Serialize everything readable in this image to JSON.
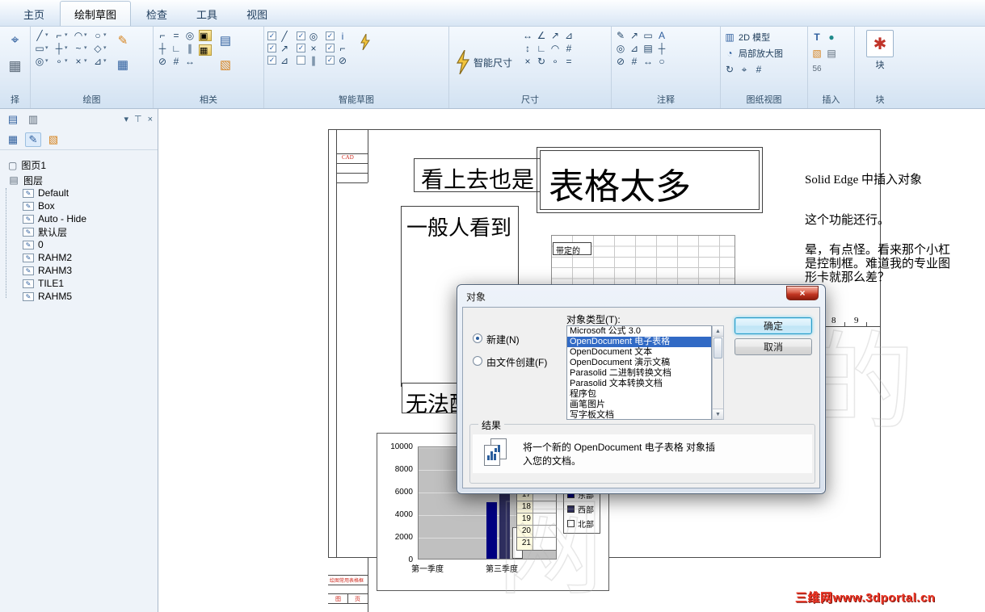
{
  "tabs": {
    "items": [
      "主页",
      "绘制草图",
      "检查",
      "工具",
      "视图"
    ],
    "active_index": 1
  },
  "ribbon": {
    "groups": {
      "select": "择",
      "draw": "绘图",
      "relate": "相关",
      "intellisketch": "智能草图",
      "dimension": "尺寸",
      "annotation": "注释",
      "drawing_views": "图纸视图",
      "insert": "插入",
      "block": "块"
    },
    "buttons": {
      "smart_dimension": "智能尺寸",
      "model_2d": "2D 模型",
      "detail_view": "局部放大图",
      "block": "块"
    }
  },
  "icons": {
    "caret": "▾",
    "cursor": "⌖",
    "fence": "▦",
    "line": "╱",
    "corner": "⌐",
    "circle": "○",
    "ellipse": "◯",
    "rect": "▭",
    "diamond": "◇",
    "arc": "◠",
    "curve": "~",
    "plus": "┼",
    "equal": "=",
    "perp": "∟",
    "parallel": "∥",
    "target": "◎",
    "dot": "∘",
    "angle": "∠",
    "tri": "⊿",
    "cross": "×",
    "tangent": "⊘",
    "info": "i",
    "check": "✓",
    "pencil": "✎",
    "dim_h": "↔",
    "dim_v": "↕",
    "leader": "↗",
    "text": "A",
    "table": "▤",
    "view2d": "▥",
    "detail": "◔",
    "refresh": "↻",
    "hash": "#",
    "letterT": "T",
    "sphere": "●",
    "image": "▧",
    "star": "✱",
    "pin": "⊤",
    "close": "×",
    "chevron_down": "▾",
    "lock": "▣",
    "num56": "56",
    "page": "▢",
    "layers": "▤"
  },
  "panel": {
    "sheet": "图页1",
    "root": "图层",
    "layers": [
      "Default",
      "Box",
      "Auto - Hide",
      "默认层",
      "0",
      "RAHM2",
      "RAHM3",
      "TILE1",
      "RAHM5"
    ]
  },
  "canvas": {
    "textbox_1": "看上去也是",
    "textbox_2": "表格太多",
    "textbox_3": "一般人看到",
    "textbox_4": "无法配",
    "grid_label": "带定的",
    "cad_stamp": "CAD",
    "title_block_row": "绘图常用表格框",
    "title_block_c1": "图",
    "title_block_c2": "页",
    "ruler_8": "8",
    "ruler_9": "9",
    "note_1": "Solid Edge 中插入对象",
    "note_2": "这个功能还行。",
    "note_3": "晕，有点怪。看来那个小杠",
    "note_4": "是控制框。难道我的专业图",
    "note_5": "形卡就那么差？",
    "watermark_url": "三维网www.3dportal.cn",
    "watermark_glyph_1": "的",
    "watermark_glyph_2": "网"
  },
  "chart_data": {
    "type": "bar",
    "title": "",
    "categories": [
      "第一季度",
      "第三季度"
    ],
    "y_ticks": [
      "10000",
      "8000",
      "6000",
      "4000",
      "2000",
      "0"
    ],
    "ylim": [
      0,
      10000
    ],
    "legend": [
      "东部",
      "西部",
      "北部"
    ],
    "legend_position": "right",
    "plot_background": "#c0c0c0",
    "grid": true,
    "data_table_values": [
      "17",
      "18",
      "19",
      "20",
      "21"
    ],
    "series": [
      {
        "name": "东部",
        "color": "#000080",
        "visible_values": [
          null,
          5000
        ]
      },
      {
        "name": "西部",
        "color": "#2e2e5e",
        "visible_values": [
          null,
          6000
        ]
      },
      {
        "name": "北部",
        "color": "#ffffff",
        "visible_values": [
          null,
          2800
        ]
      }
    ]
  },
  "dialog": {
    "title": "对象",
    "type_label": "对象类型(T):",
    "radio_new": "新建(N)",
    "radio_file": "由文件创建(F)",
    "list_items": [
      "Microsoft 公式 3.0",
      "OpenDocument 电子表格",
      "OpenDocument 文本",
      "OpenDocument 演示文稿",
      "Parasolid 二进制转换文档",
      "Parasolid 文本转换文档",
      "程序包",
      "画笔图片",
      "写字板文档"
    ],
    "selected_index": 1,
    "ok": "确定",
    "cancel": "取消",
    "result_label": "结果",
    "result_line1": "将一个新的 OpenDocument 电子表格 对象插",
    "result_line2": "入您的文档。"
  },
  "colors": {
    "selection_blue": "#316ac5",
    "ribbon_bg": "#e2ecf7",
    "watermark_red": "#ee3524",
    "plot_gray": "#c0c0c0"
  }
}
